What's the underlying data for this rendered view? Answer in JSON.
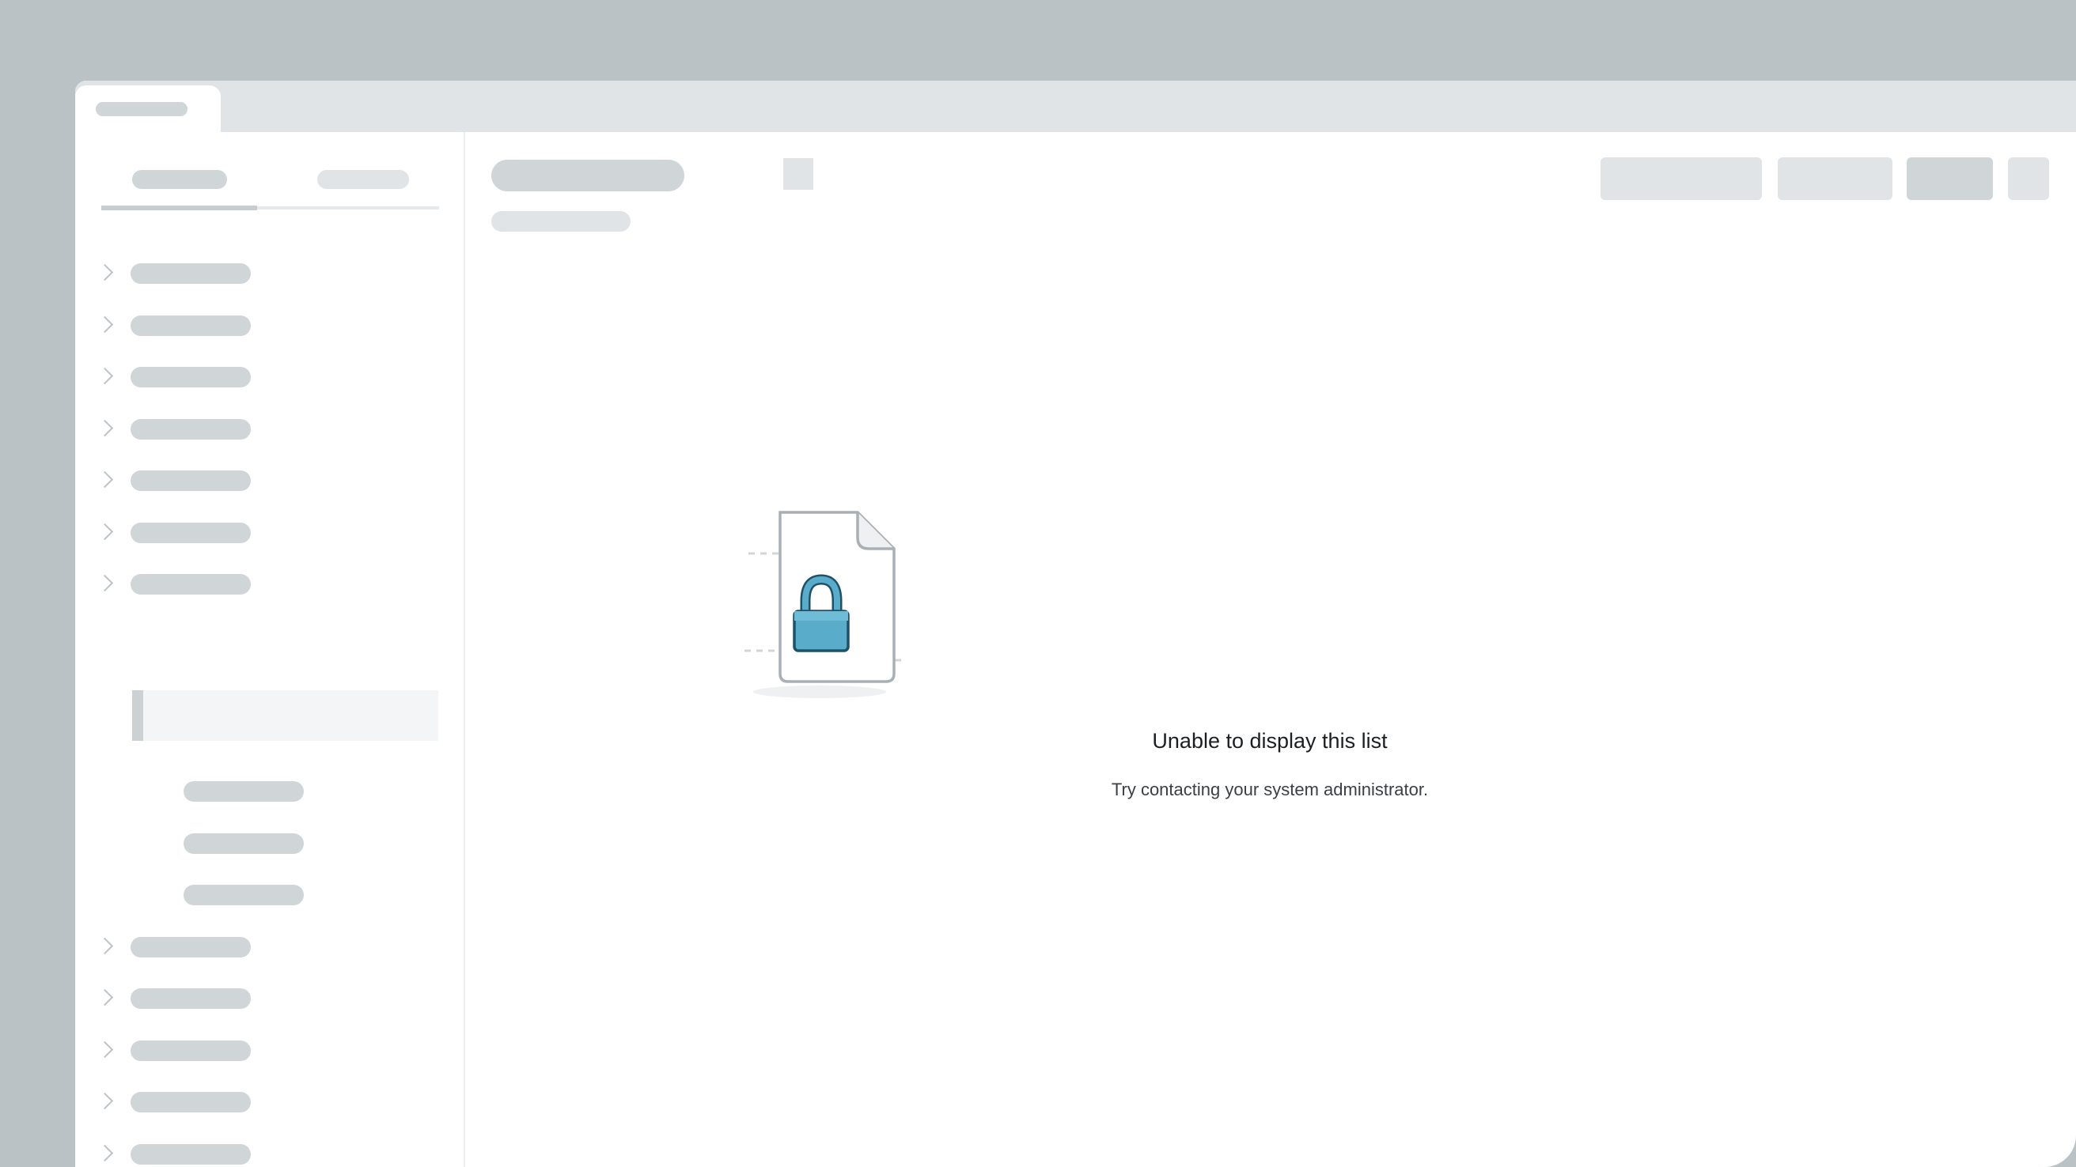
{
  "empty_state": {
    "title": "Unable to display this list",
    "message": "Try contacting your system administrator.",
    "icon": "locked-document-icon",
    "accent_color": "#5aaccb"
  },
  "sidebar": {
    "tree_items_before_selected": 7,
    "child_items": 3,
    "tree_items_after": 5
  }
}
